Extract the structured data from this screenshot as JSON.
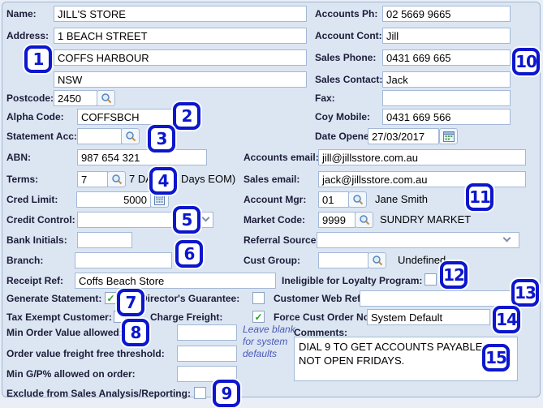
{
  "left": {
    "name_label": "Name:",
    "name": "JILL'S STORE",
    "address_label": "Address:",
    "address1": "1 BEACH STREET",
    "address2": "COFFS HARBOUR",
    "address3": "NSW",
    "postcode_label": "Postcode:",
    "postcode": "2450",
    "alpha_label": "Alpha Code:",
    "alpha": "COFFSBCH",
    "statement_label": "Statement Acc:",
    "statement": "",
    "abn_label": "ABN:",
    "abn": "987 654 321",
    "terms_label": "Terms:",
    "terms": "7",
    "terms_desc": "7 DAYS (7 Days EOM)",
    "cred_label": "Cred Limit:",
    "cred": "5000",
    "credit_control_label": "Credit Control:",
    "credit_control": "",
    "bank_label": "Bank Initials:",
    "bank": "",
    "branch_label": "Branch:",
    "branch": "",
    "receipt_label": "Receipt Ref:",
    "receipt": "Coffs Beach Store"
  },
  "right": {
    "accounts_ph_label": "Accounts Ph:",
    "accounts_ph": "02 5669 9665",
    "account_cont_label": "Account Cont:",
    "account_cont": "Jill",
    "sales_phone_label": "Sales Phone:",
    "sales_phone": "0431 669 665",
    "sales_contact_label": "Sales Contact:",
    "sales_contact": "Jack",
    "fax_label": "Fax:",
    "fax": "",
    "coy_mobile_label": "Coy Mobile:",
    "coy_mobile": "0431 669 566",
    "date_opened_label": "Date Opened:",
    "date_opened": "27/03/2017",
    "accounts_email_label": "Accounts email:",
    "accounts_email": "jill@jillsstore.com.au",
    "sales_email_label": "Sales email:",
    "sales_email": "jack@jillsstore.com.au",
    "account_mgr_label": "Account Mgr:",
    "account_mgr": "01",
    "account_mgr_name": "Jane Smith",
    "market_code_label": "Market Code:",
    "market_code": "9999",
    "market_code_name": "SUNDRY MARKET",
    "referral_label": "Referral Source:",
    "referral": "",
    "cust_group_label": "Cust Group:",
    "cust_group": "",
    "cust_group_name": "Undefined"
  },
  "checks": {
    "generate_statement_label": "Generate Statement:",
    "generate_statement_mark": "✓",
    "directors_guarantee_label": "Director's Guarantee:",
    "directors_guarantee_mark": "",
    "tax_exempt_label": "Tax Exempt Customer:",
    "tax_exempt_mark": "",
    "charge_freight_label": "Charge Freight:",
    "charge_freight_mark": "✓",
    "ineligible_label": "Ineligible for Loyalty Program:",
    "ineligible_mark": "",
    "exclude_label": "Exclude from Sales Analysis/Reporting:",
    "exclude_mark": "",
    "customer_web_ref_label": "Customer Web Ref:",
    "customer_web_ref": "",
    "force_cust_label": "Force Cust Order No:",
    "force_cust": "System Default"
  },
  "bottom": {
    "min_order_label": "Min Order Value allowed:",
    "min_order": "",
    "freight_free_label": "Order value freight free threshold:",
    "freight_free": "",
    "min_gp_label": "Min G/P% allowed on order:",
    "min_gp": "",
    "hint": "Leave blank for system defaults",
    "comments_label": "Comments:",
    "comments": "DIAL 9 TO GET ACCOUNTS PAYABLE.\nNOT OPEN FRIDAYS."
  },
  "callouts": {
    "c1": "1",
    "c2": "2",
    "c3": "3",
    "c4": "4",
    "c5": "5",
    "c6": "6",
    "c7": "7",
    "c8": "8",
    "c9": "9",
    "c10": "10",
    "c11": "11",
    "c12": "12",
    "c13": "13",
    "c14": "14",
    "c15": "15"
  },
  "colors": {
    "callout_blue": "#0b16cd",
    "check_green": "#23a123",
    "panel_bg": "#dce6f3"
  }
}
